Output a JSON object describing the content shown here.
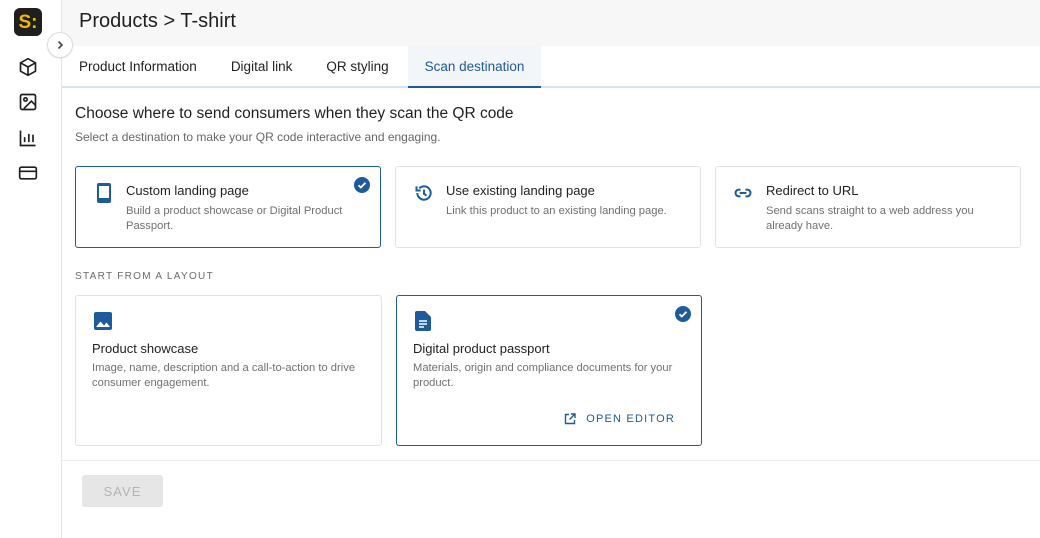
{
  "sidebar": {
    "logo_text": "S:",
    "logo_accent": "#f5b800",
    "icons": [
      "box-icon",
      "image-icon",
      "chart-icon",
      "card-icon"
    ]
  },
  "header": {
    "title": "Products > T-shirt"
  },
  "tabs": [
    {
      "label": "Product Information",
      "active": false
    },
    {
      "label": "Digital link",
      "active": false
    },
    {
      "label": "QR styling",
      "active": false
    },
    {
      "label": "Scan destination",
      "active": true
    }
  ],
  "destination": {
    "title": "Choose where to send consumers when they scan the QR code",
    "subtitle": "Select a destination to make your QR code interactive and engaging.",
    "options": [
      {
        "icon": "phone-icon",
        "title": "Custom landing page",
        "desc": "Build a product showcase or Digital Product Passport.",
        "selected": true
      },
      {
        "icon": "history-icon",
        "title": "Use existing landing page",
        "desc": "Link this product to an existing landing page.",
        "selected": false
      },
      {
        "icon": "link-icon",
        "title": "Redirect to URL",
        "desc": "Send scans straight to a web address you already have.",
        "selected": false
      }
    ]
  },
  "layouts": {
    "label": "START FROM A LAYOUT",
    "items": [
      {
        "icon": "image-icon",
        "title": "Product showcase",
        "desc": "Image, name, description and a call-to-action to drive consumer engagement.",
        "selected": false
      },
      {
        "icon": "document-icon",
        "title": "Digital product passport",
        "desc": "Materials, origin and compliance documents for your product.",
        "selected": true,
        "action": "OPEN EDITOR"
      }
    ]
  },
  "footer": {
    "save_label": "SAVE"
  },
  "colors": {
    "accent": "#1d5b9a",
    "selected_border": "#1d5b9a"
  }
}
